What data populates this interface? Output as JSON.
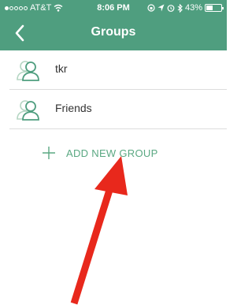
{
  "status_bar": {
    "carrier": "AT&T",
    "time": "8:06 PM",
    "battery": "43%",
    "battery_level": 0.43,
    "signal_bars_filled": 1,
    "signal_bars_total": 5,
    "icons": [
      "wifi-icon",
      "screen-lock-icon",
      "location-icon",
      "alarm-icon",
      "bluetooth-icon",
      "battery-icon"
    ]
  },
  "nav": {
    "title": "Groups",
    "back_icon": "chevron-left-icon"
  },
  "groups": [
    {
      "name": "tkr",
      "icon": "group-icon"
    },
    {
      "name": "Friends",
      "icon": "group-icon"
    }
  ],
  "add_group": {
    "label": "ADD NEW GROUP",
    "icon": "plus-icon"
  },
  "colors": {
    "header": "#4f9e7f",
    "accent": "#5aa882",
    "arrow": "#e8281c",
    "divider": "#dddddd"
  },
  "annotation": {
    "icon": "red-arrow-icon"
  }
}
